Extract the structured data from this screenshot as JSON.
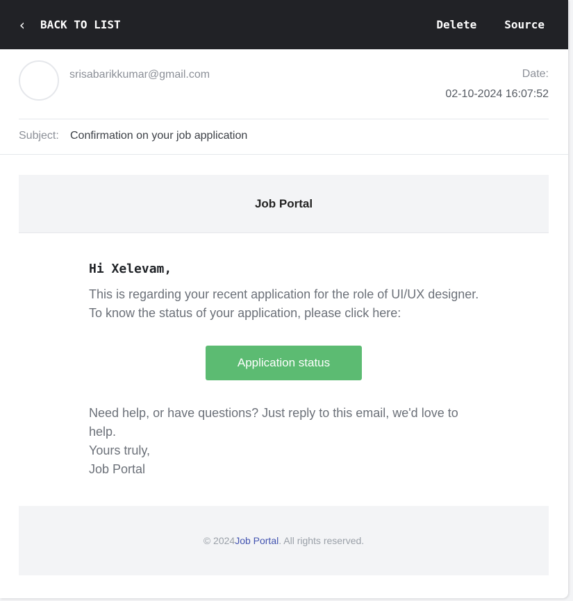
{
  "toolbar": {
    "back_icon": "chevron-left-icon",
    "back_label": "BACK TO LIST",
    "delete_label": "Delete",
    "source_label": "Source"
  },
  "message": {
    "from": "srisabarikkumar@gmail.com",
    "date_label": "Date:",
    "date_value": "02-10-2024 16:07:52",
    "subject_label": "Subject:",
    "subject_value": "Confirmation on your job application"
  },
  "email_body": {
    "brand": "Job Portal",
    "greeting": "Hi Xelevam,",
    "paragraph1": [
      "This is regarding your recent application for the role of UI/UX designer.",
      "To know the status of your application, please click here:"
    ],
    "cta_label": "Application status",
    "paragraph2": [
      "Need help, or have questions? Just reply to this email, we'd love to",
      "help.",
      "Yours truly,",
      "Job Portal"
    ],
    "footer": {
      "prefix": "© 2024 ",
      "link": "Job Portal",
      "suffix": ". All rights reserved."
    }
  },
  "colors": {
    "topbar": "#212226",
    "cta": "#5cbb72",
    "footer_link": "#4253b0"
  }
}
